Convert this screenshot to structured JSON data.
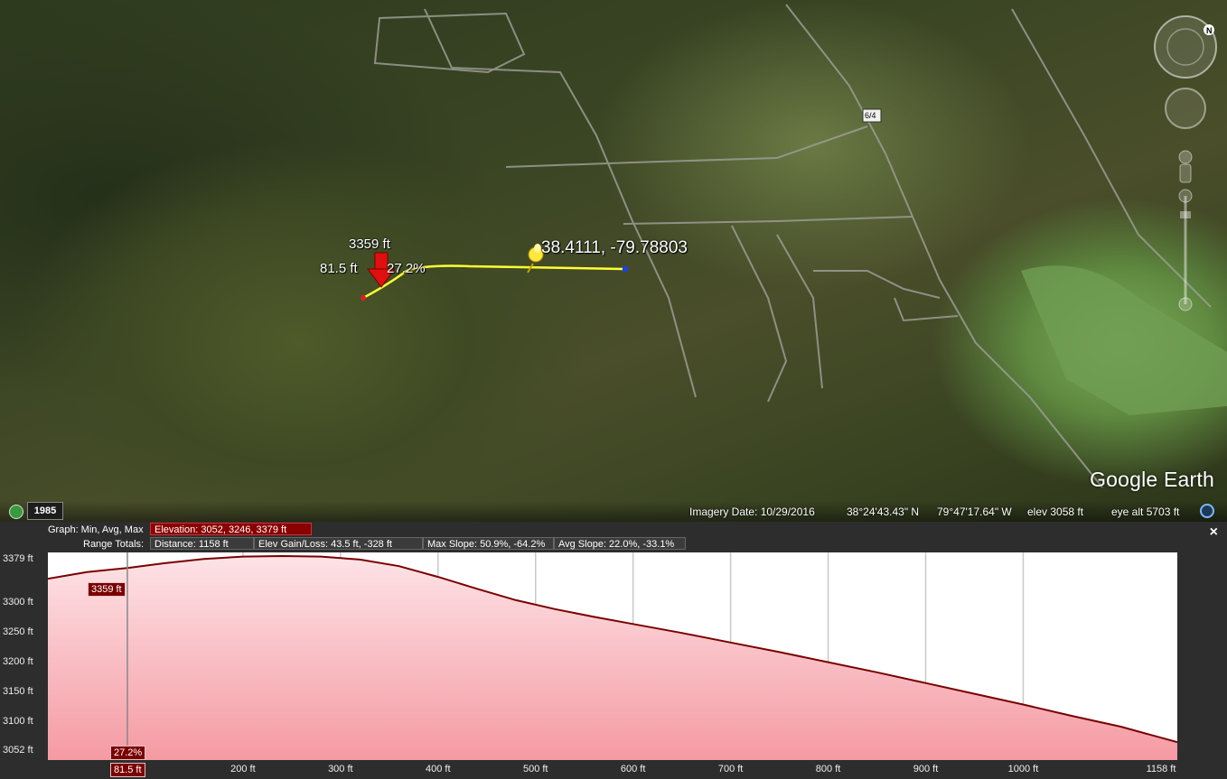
{
  "map": {
    "marker_elevation": "3359 ft",
    "marker_distance": "81.5 ft",
    "marker_slope": "27.2%",
    "placemark_label": "38.4111, -79.78803",
    "road_sign": "6/4",
    "logo_text": "Google Earth",
    "year_badge": "1985"
  },
  "status": {
    "imagery_date": "Imagery Date: 10/29/2016",
    "lat": "38°24'43.43\" N",
    "lon": "79°47'17.64\" W",
    "elev": "elev  3058 ft",
    "eye_alt": "eye alt   5703 ft"
  },
  "profile": {
    "graph_label": "Graph: Min, Avg, Max",
    "elevation_box": "Elevation: 3052, 3246, 3379 ft",
    "range_label": "Range Totals:",
    "distance_box": "Distance: 1158 ft",
    "gain_box": "Elev Gain/Loss: 43.5 ft, -328 ft",
    "max_slope_box": "Max Slope: 50.9%, -64.2%",
    "avg_slope_box": "Avg Slope: 22.0%, -33.1%",
    "close_symbol": "×",
    "cursor_elevation_tag": "3359 ft",
    "cursor_slope_tag": "27.2%",
    "cursor_distance_tag": "81.5 ft",
    "last_x_label": "1158 ft"
  },
  "chart_data": {
    "type": "area",
    "xlabel": "",
    "ylabel": "",
    "x_unit": "ft",
    "y_unit": "ft",
    "xlim": [
      0,
      1158
    ],
    "ylim": [
      3037,
      3385
    ],
    "y_ticks": [
      3379,
      3300,
      3250,
      3200,
      3150,
      3100,
      3052
    ],
    "y_tick_labels": [
      "3379 ft",
      "3300 ft",
      "3250 ft",
      "3200 ft",
      "3150 ft",
      "3100 ft",
      "3052 ft"
    ],
    "x_ticks": [
      200,
      300,
      400,
      500,
      600,
      700,
      800,
      900,
      1000
    ],
    "x_tick_labels": [
      "200 ft",
      "300 ft",
      "400 ft",
      "500 ft",
      "600 ft",
      "700 ft",
      "800 ft",
      "900 ft",
      "1000 ft"
    ],
    "cursor_x": 81.5,
    "cursor_y": 3359,
    "series": [
      {
        "x": [
          0,
          40,
          81.5,
          120,
          160,
          200,
          240,
          280,
          320,
          360,
          400,
          440,
          480,
          520,
          560,
          600,
          650,
          700,
          750,
          800,
          850,
          900,
          950,
          1000,
          1050,
          1100,
          1158
        ],
        "values": [
          3341,
          3352,
          3359,
          3367,
          3374,
          3378,
          3379,
          3378,
          3373,
          3362,
          3344,
          3324,
          3305,
          3290,
          3277,
          3265,
          3250,
          3234,
          3218,
          3201,
          3184,
          3166,
          3148,
          3130,
          3111,
          3093,
          3067
        ]
      }
    ],
    "fill_color": "#f6a4ac",
    "line_color": "#7a0000",
    "grid": true
  }
}
